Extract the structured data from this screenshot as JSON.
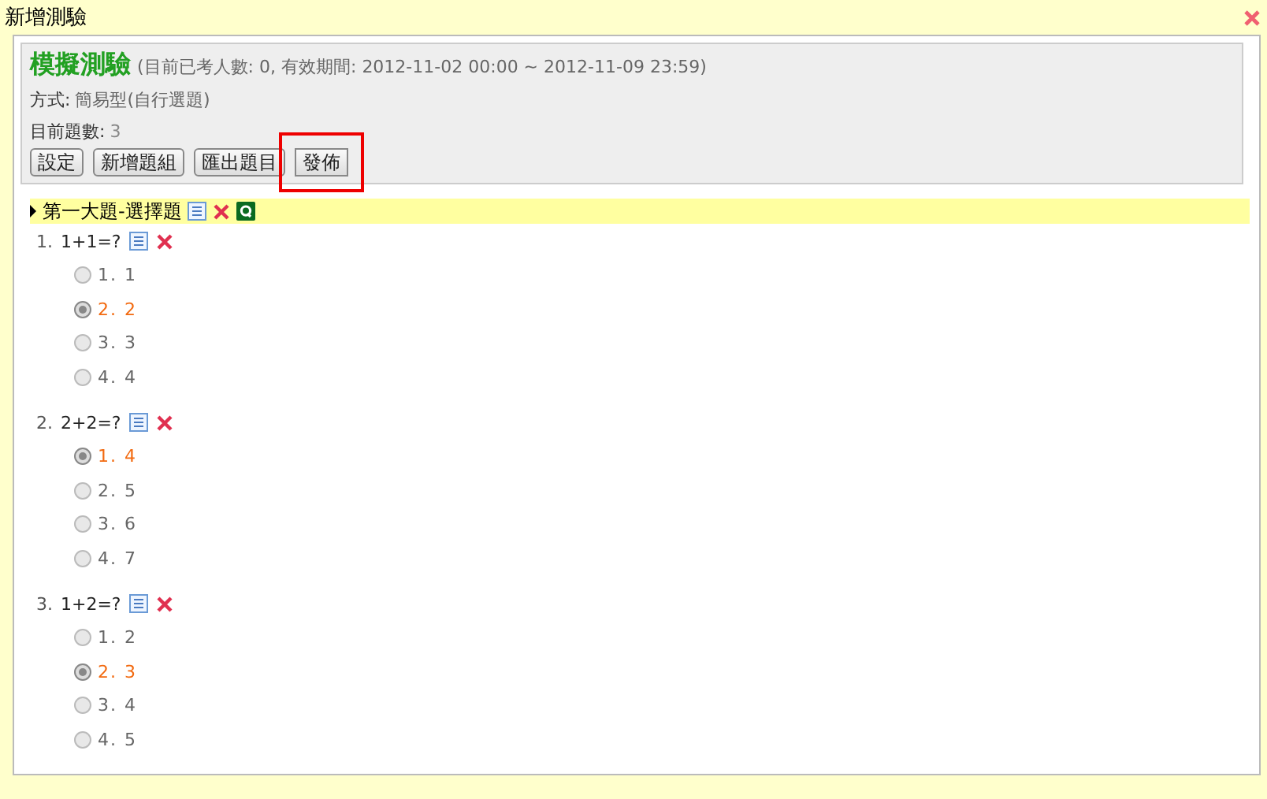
{
  "window": {
    "title": "新增測驗"
  },
  "exam": {
    "title": "模擬測驗",
    "info": "(目前已考人數: 0, 有效期間: 2012-11-02 00:00 ~ 2012-11-09 23:59)",
    "mode_label": "方式:",
    "mode": "簡易型(自行選題)",
    "count_label": "目前題數:",
    "count": "3"
  },
  "buttons": [
    {
      "label": "設定",
      "highlighted": false
    },
    {
      "label": "新增題組",
      "highlighted": false
    },
    {
      "label": "匯出題目",
      "highlighted": false
    },
    {
      "label": "發佈",
      "highlighted": true
    }
  ],
  "section": {
    "title": "第一大題-選擇題",
    "questions": [
      {
        "number": "1.",
        "text": "1+1=?",
        "options": [
          {
            "label": "1. 1",
            "selected": false
          },
          {
            "label": "2. 2",
            "selected": true
          },
          {
            "label": "3. 3",
            "selected": false
          },
          {
            "label": "4. 4",
            "selected": false
          }
        ]
      },
      {
        "number": "2.",
        "text": "2+2=?",
        "options": [
          {
            "label": "1. 4",
            "selected": true
          },
          {
            "label": "2. 5",
            "selected": false
          },
          {
            "label": "3. 6",
            "selected": false
          },
          {
            "label": "4. 7",
            "selected": false
          }
        ]
      },
      {
        "number": "3.",
        "text": "1+2=?",
        "options": [
          {
            "label": "1. 2",
            "selected": false
          },
          {
            "label": "2. 3",
            "selected": true
          },
          {
            "label": "3. 4",
            "selected": false
          },
          {
            "label": "4. 5",
            "selected": false
          }
        ]
      }
    ]
  }
}
